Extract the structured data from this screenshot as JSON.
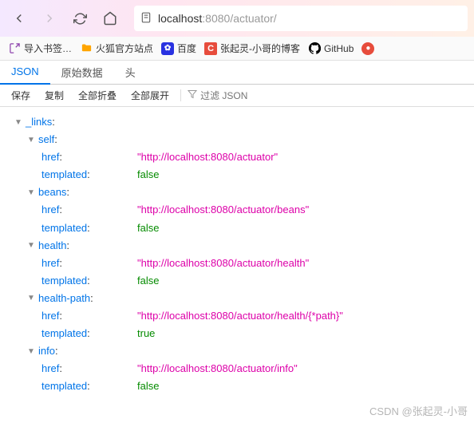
{
  "nav": {
    "url_host": "localhost",
    "url_port": ":8080",
    "url_path": "/actuator/"
  },
  "bookmarks": {
    "import": "导入书签…",
    "folder": "火狐官方站点",
    "baidu": "百度",
    "blog": "张起灵-小哥的博客",
    "github": "GitHub"
  },
  "tabs": {
    "json": "JSON",
    "raw": "原始数据",
    "head": "头"
  },
  "toolbar": {
    "save": "保存",
    "copy": "复制",
    "collapse": "全部折叠",
    "expand": "全部展开",
    "filter_placeholder": "过滤 JSON"
  },
  "json": {
    "links_key": "_links",
    "entries": [
      {
        "name": "self",
        "href": "\"http://localhost:8080/actuator\"",
        "templated": "false"
      },
      {
        "name": "beans",
        "href": "\"http://localhost:8080/actuator/beans\"",
        "templated": "false"
      },
      {
        "name": "health",
        "href": "\"http://localhost:8080/actuator/health\"",
        "templated": "false"
      },
      {
        "name": "health-path",
        "href": "\"http://localhost:8080/actuator/health/{*path}\"",
        "templated": "true"
      },
      {
        "name": "info",
        "href": "\"http://localhost:8080/actuator/info\"",
        "templated": "false"
      }
    ],
    "href_key": "href",
    "templated_key": "templated"
  },
  "watermark": "CSDN @张起灵-小哥"
}
